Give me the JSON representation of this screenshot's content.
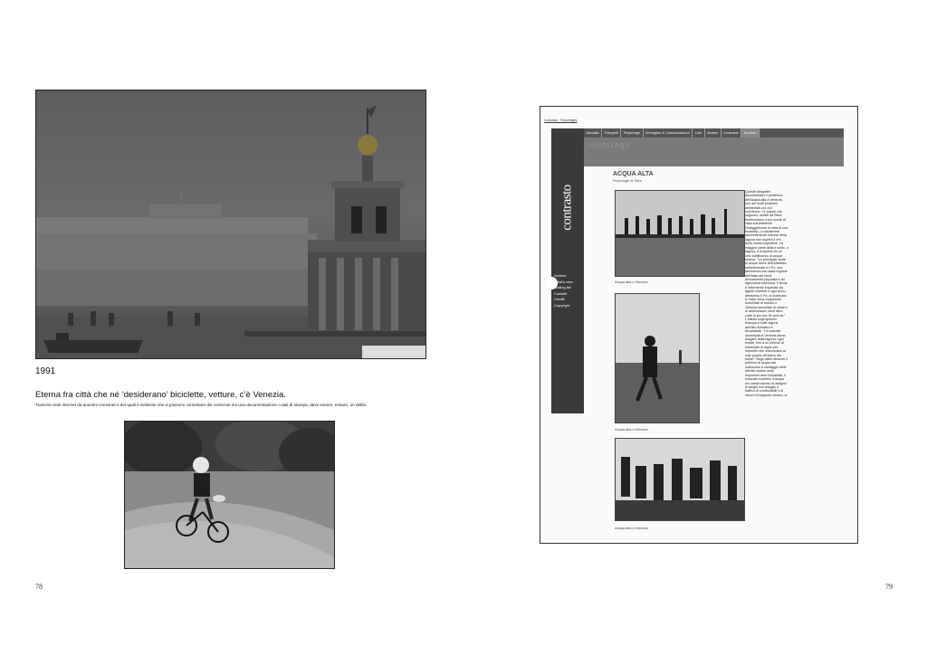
{
  "left_page": {
    "year": "1991",
    "heading": "Eterna fra città che né ‘desiderano’ biciclette, vetture, c’è Venezia.",
    "caption": "Trascrivo testi internet da anonimi censurati e dei quali è evidente che si possono contestare dei contenuti ma una documentazione o dati di stampa, deve essere, restare, un diritto.",
    "page_number": "78"
  },
  "right_page": {
    "page_number": "79",
    "website": {
      "header": "Contrasto · Reportages",
      "brand": "contrasto",
      "banner_text": "reportage",
      "nav": [
        "Attualità",
        "Fotografi",
        "Reportage",
        "Immagine & Comunicazione",
        "Libri",
        "Mostre",
        "Contrasto",
        "Archivio"
      ],
      "active_nav_index": 7,
      "side_menu": [
        "Archive",
        "What's new",
        "Mailing list",
        "Contatti",
        "Crediti",
        "Copyright"
      ],
      "article_title": "ACQUA ALTA",
      "article_subtitle": "Reportage di Silva",
      "photo_captions": [
        "Acqua alta a Venezia.",
        "Acqua alta a Venezia.",
        "Acqua alta a Venezia."
      ],
      "column_text": "Queste fotografie documentano il problema dell'acqua alta a Venezia, uno dei molti problemi ambientali con cui convivono. Le parole che seguono, scritte da Silva, testimoniano il suo punto di vista sull'ambiente. Osteggiamone la rotta di una bicicletta. Le lanaferme perennemente emerse della laguna non supera il 4% della nostra superficie. La maggior parte della e sotto, o laguna, è ricoperta da un velo sottilissimo di acqua marina. \"La principale fonte di acque dolce dell'Adriatico settentrionale è il Po, che attraversa una vasta regione dell'Italia del Nord densamente popolata e ad agricoltura intensiva. Il fiume è fortemente inquinato da agenti nutrienti e ogni anno, attraverso il Po, si scaricano in mare circa cinquemila tonnellate di fosforo e 100mila tonnellate di nitrati e di ammoniaca: circa dieci volte di più che 50 anni fa.\" L'effetto sugli specchi d'acqua e sulle lagune dell'alto Adriatico è devastante. \"Le autorità municipali di Venezia fanno dragare dalla laguna, ogni estate, fino a un milione di tonnellate di alghe per impedire che marciscano al sole proprio all'arrivo dei turisti.\" Negli ultimi decenni il prelievo di acqua dal sottosuolo a vantaggio delle attività umane nelle imponenti aree industriali, il mancato ricambio d'acqua nei canali dovuto al ristagno di fanghi non dragati, il traffico di combustibili e di mezzi di trasporto urbano, le"
    }
  }
}
